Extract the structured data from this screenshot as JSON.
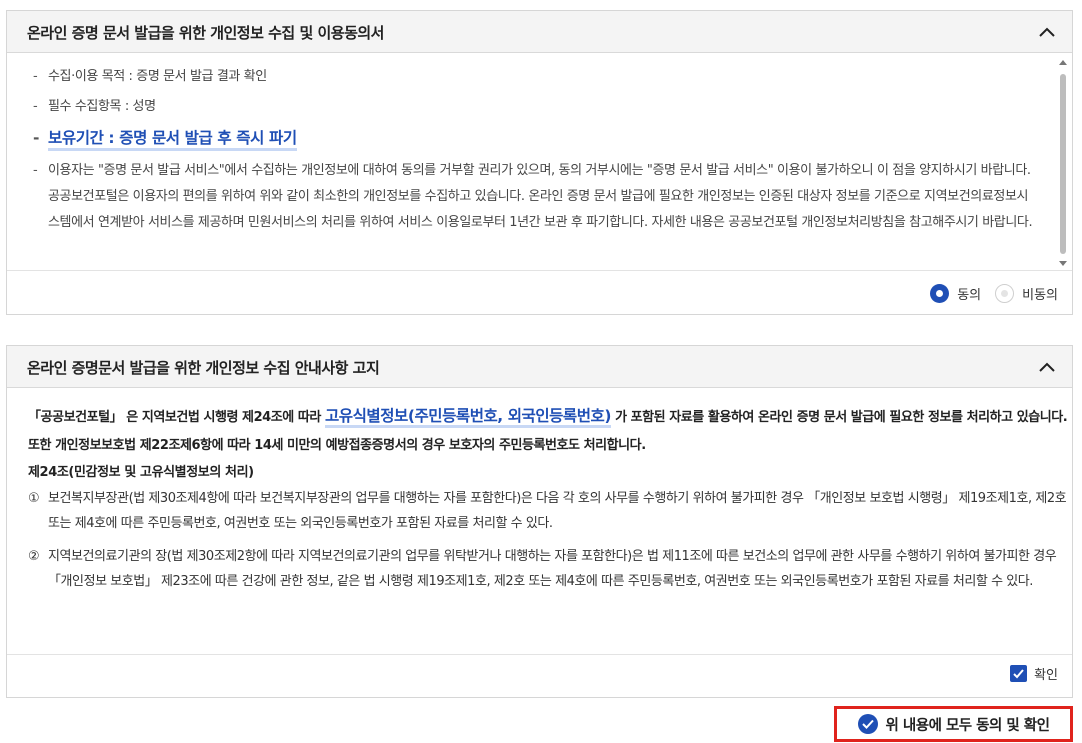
{
  "consent_panel": {
    "title": "온라인 증명 문서 발급을 위한 개인정보 수집 및 이용동의서",
    "items": [
      "수집·이용 목적 : 증명 문서 발급 결과 확인",
      "필수 수집항목 : 성명",
      "보유기간 : 증명 문서 발급 후 즉시 파기",
      "이용자는 \"증명 문서 발급 서비스\"에서 수집하는 개인정보에 대하여 동의를 거부할 권리가 있으며, 동의 거부시에는 \"증명 문서 발급 서비스\" 이용이 불가하오니 이 점을 양지하시기 바랍니다. 공공보건포털은 이용자의 편의를 위하여 위와 같이 최소한의 개인정보를 수집하고 있습니다. 온라인 증명 문서 발급에 필요한 개인정보는 인증된 대상자 정보를 기준으로 지역보건의료정보시스템에서 연계받아 서비스를 제공하며 민원서비스의 처리를 위하여 서비스 이용일로부터 1년간 보관 후 파기합니다. 자세한 내용은 공공보건포털 개인정보처리방침을 참고해주시기 바랍니다."
    ],
    "radio_agree": "동의",
    "radio_disagree": "비동의",
    "selected": "동의"
  },
  "notice_panel": {
    "title": "온라인 증명문서 발급을 위한 개인정보 수집 안내사항 고지",
    "intro_pre": "「공공보건포털」 은 지역보건법 시행령 제24조에 따라 ",
    "intro_highlight": "고유식별정보(주민등록번호, 외국인등록번호)",
    "intro_post": " 가 포함된 자료를 활용하여 온라인 증명 문서 발급에 필요한 정보를 처리하고 있습니다. 또한 개인정보보호법 제22조제6항에 따라 14세 미만의 예방접종증명서의 경우 보호자의 주민등록번호도 처리합니다.",
    "article_title": "제24조(민감정보 및 고유식별정보의 처리)",
    "articles": [
      {
        "num": "①",
        "text": "보건복지부장관(법 제30조제4항에 따라 보건복지부장관의 업무를 대행하는 자를 포함한다)은 다음 각 호의 사무를 수행하기 위하여 불가피한 경우 「개인정보 보호법 시행령」 제19조제1호, 제2호 또는 제4호에 따른 주민등록번호, 여권번호 또는 외국인등록번호가 포함된 자료를 처리할 수 있다."
      },
      {
        "num": "②",
        "text": "지역보건의료기관의 장(법 제30조제2항에 따라 지역보건의료기관의 업무를 위탁받거나 대행하는 자를 포함한다)은 법 제11조에 따른 보건소의 업무에 관한 사무를 수행하기 위하여 불가피한 경우 「개인정보 보호법」 제23조에 따른 건강에 관한 정보, 같은 법 시행령 제19조제1호, 제2호 또는 제4호에 따른 주민등록번호, 여권번호 또는 외국인등록번호가 포함된 자료를 처리할 수 있다."
      }
    ],
    "confirm_label": "확인",
    "confirmed": true
  },
  "agree_all_label": "위 내용에 모두 동의 및 확인",
  "colors": {
    "accent": "#1f4fb5",
    "highlight_underline": "#c8d8f5",
    "alert_border": "#e0231c"
  },
  "icons": [
    "chevron-up-icon",
    "radio-checked-icon",
    "radio-unchecked-icon",
    "checkbox-checked-icon",
    "check-circle-icon"
  ]
}
